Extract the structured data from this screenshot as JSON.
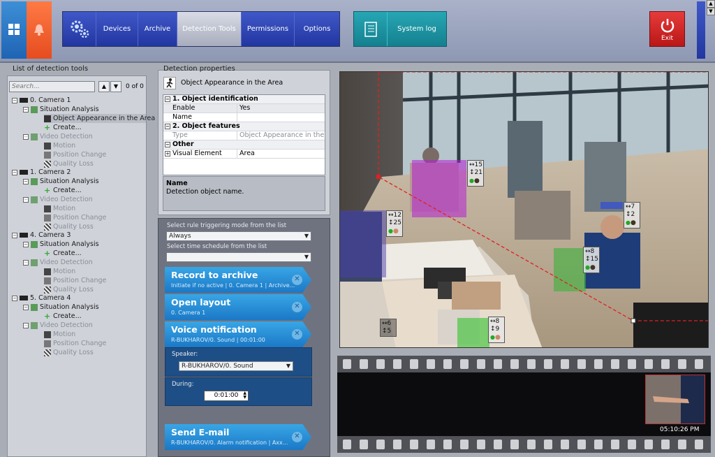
{
  "nav": {
    "devices": "Devices",
    "archive": "Archive",
    "detection_tools": "Detection Tools",
    "permissions": "Permissions",
    "options": "Options",
    "system_log": "System log",
    "exit": "Exit"
  },
  "left_panel": {
    "title": "List of detection tools",
    "search_placeholder": "Search...",
    "count": "0 of 0",
    "tree": {
      "cam1": "0. Camera 1",
      "cam2": "1. Camera 2",
      "cam3": "4. Camera 3",
      "cam4": "5. Camera 4",
      "situation": "Situation Analysis",
      "object_appearance": "Object Appearance in the Area",
      "create": "Create...",
      "video_detection": "Video Detection",
      "motion": "Motion",
      "position_change": "Position Change",
      "quality_loss": "Quality Loss"
    }
  },
  "properties": {
    "title": "Detection properties",
    "object_title": "Object Appearance in the Area",
    "cat1": "1. Object identification",
    "enable_key": "Enable",
    "enable_val": "Yes",
    "name_key": "Name",
    "cat2": "2. Object features",
    "type_key": "Type",
    "type_val": "Object Appearance in the Area",
    "other": "Other",
    "visual_key": "Visual Element",
    "visual_val": "Area",
    "desc_title": "Name",
    "desc_text": "Detection object name."
  },
  "actions": {
    "mode_label": "Select rule triggering mode from the list",
    "mode_value": "Always",
    "schedule_label": "Select time schedule from the list",
    "schedule_value": "",
    "tabs": [
      {
        "title": "Record to archive",
        "sub": "Initiate if no active | 0. Camera 1 | Archive..."
      },
      {
        "title": "Open layout",
        "sub": "0. Camera 1"
      },
      {
        "title": "Voice notification",
        "sub": "R-BUKHAROV/0. Sound | 00:01:00"
      },
      {
        "title": "Send E-mail",
        "sub": "R-BUKHAROV/0. Alarm notification | Axx..."
      }
    ],
    "speaker_label": "Speaker:",
    "speaker_value": "R-BUKHAROV/0. Sound",
    "during_label": "During:",
    "during_value": "0:01:00"
  },
  "video": {
    "labels": [
      {
        "a": "15",
        "b": "21"
      },
      {
        "a": "12",
        "b": "25"
      },
      {
        "a": "7",
        "b": "2"
      },
      {
        "a": "8",
        "b": "15"
      },
      {
        "a": "8",
        "b": "9"
      },
      {
        "a": "6",
        "b": "5"
      }
    ],
    "timestamp": "05:10:26 PM"
  },
  "colors": {
    "nav_blue": "#2a3fae",
    "teal": "#1b93a2",
    "exit_red": "#d12424",
    "tab_blue": "#2a8ed8"
  }
}
